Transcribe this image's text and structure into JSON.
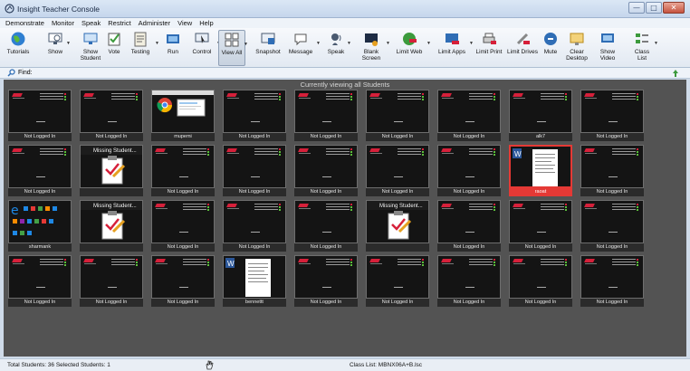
{
  "window": {
    "title": "Insight Teacher Console",
    "min_glyph": "—",
    "max_glyph": "□",
    "close_glyph": "✕"
  },
  "menu": [
    "Demonstrate",
    "Monitor",
    "Speak",
    "Restrict",
    "Administer",
    "View",
    "Help"
  ],
  "toolbar": [
    {
      "label": "Tutorials",
      "icon": "globe-icon"
    },
    {
      "label": "Show",
      "icon": "monitor-show-icon",
      "dropdown": true
    },
    {
      "label": "Show Student",
      "icon": "monitor-student-icon"
    },
    {
      "label": "Vote",
      "icon": "vote-check-icon"
    },
    {
      "label": "Testing",
      "icon": "clipboard-icon",
      "dropdown": true
    },
    {
      "label": "Run",
      "icon": "run-icon"
    },
    {
      "label": "Control",
      "icon": "control-icon",
      "dropdown": true
    },
    {
      "label": "View All",
      "icon": "view-all-icon",
      "dropdown": true,
      "active": true
    },
    {
      "label": "Snapshot",
      "icon": "snapshot-icon"
    },
    {
      "label": "Message",
      "icon": "message-icon",
      "dropdown": true
    },
    {
      "label": "Speak",
      "icon": "speak-icon",
      "dropdown": true
    },
    {
      "label": "Blank Screen",
      "icon": "blank-screen-icon",
      "dropdown": true
    },
    {
      "label": "Limit Web",
      "icon": "limit-web-icon",
      "dropdown": true
    },
    {
      "label": "Limit Apps",
      "icon": "limit-apps-icon",
      "dropdown": true
    },
    {
      "label": "Limit Print",
      "icon": "printer-icon"
    },
    {
      "label": "Limit Drives",
      "icon": "limit-drives-icon"
    },
    {
      "label": "Mute",
      "icon": "mute-icon"
    },
    {
      "label": "Clear Desktop",
      "icon": "clear-desktop-icon"
    },
    {
      "label": "Show Video",
      "icon": "video-icon"
    },
    {
      "label": "Class List",
      "icon": "class-list-icon",
      "dropdown": true
    }
  ],
  "find": {
    "label": "Find:"
  },
  "viewer": {
    "caption": "Currently viewing all Students"
  },
  "students": [
    {
      "name": "Not Logged In",
      "screen": "login"
    },
    {
      "name": "Not Logged In",
      "screen": "login"
    },
    {
      "name": "mupemi",
      "screen": "browser"
    },
    {
      "name": "Not Logged In",
      "screen": "login"
    },
    {
      "name": "Not Logged In",
      "screen": "login"
    },
    {
      "name": "Not Logged In",
      "screen": "login"
    },
    {
      "name": "Not Logged In",
      "screen": "login"
    },
    {
      "name": "alk7",
      "screen": "login"
    },
    {
      "name": "Not Logged In",
      "screen": "login"
    },
    {
      "name": "Not Logged In",
      "screen": "login"
    },
    {
      "name": "",
      "screen": "missing",
      "overlay": "Missing Student..."
    },
    {
      "name": "Not Logged In",
      "screen": "login"
    },
    {
      "name": "Not Logged In",
      "screen": "login"
    },
    {
      "name": "Not Logged In",
      "screen": "login"
    },
    {
      "name": "Not Logged In",
      "screen": "login"
    },
    {
      "name": "Not Logged In",
      "screen": "login"
    },
    {
      "name": "raoat",
      "screen": "word",
      "selected": true
    },
    {
      "name": "Not Logged In",
      "screen": "login"
    },
    {
      "name": "sharmank",
      "screen": "desktop"
    },
    {
      "name": "",
      "screen": "missing",
      "overlay": "Missing Student..."
    },
    {
      "name": "Not Logged In",
      "screen": "login"
    },
    {
      "name": "Not Logged In",
      "screen": "login"
    },
    {
      "name": "Not Logged In",
      "screen": "login"
    },
    {
      "name": "",
      "screen": "missing",
      "overlay": "Missing Student..."
    },
    {
      "name": "Not Logged In",
      "screen": "login"
    },
    {
      "name": "Not Logged In",
      "screen": "login"
    },
    {
      "name": "Not Logged In",
      "screen": "login"
    },
    {
      "name": "Not Logged In",
      "screen": "login"
    },
    {
      "name": "Not Logged In",
      "screen": "login"
    },
    {
      "name": "Not Logged In",
      "screen": "login"
    },
    {
      "name": "bennettt",
      "screen": "word"
    },
    {
      "name": "Not Logged In",
      "screen": "login"
    },
    {
      "name": "Not Logged In",
      "screen": "login"
    },
    {
      "name": "Not Logged In",
      "screen": "login"
    },
    {
      "name": "Not Logged In",
      "screen": "login"
    },
    {
      "name": "Not Logged In",
      "screen": "login"
    }
  ],
  "status": {
    "counts": "Total Students: 36  Selected Students: 1",
    "class_list": "Class List: MBNX06A+B.lsc"
  },
  "colors": {
    "selected": "#e53935",
    "viewer_bg": "#535353",
    "accent_red": "#d6203a"
  }
}
